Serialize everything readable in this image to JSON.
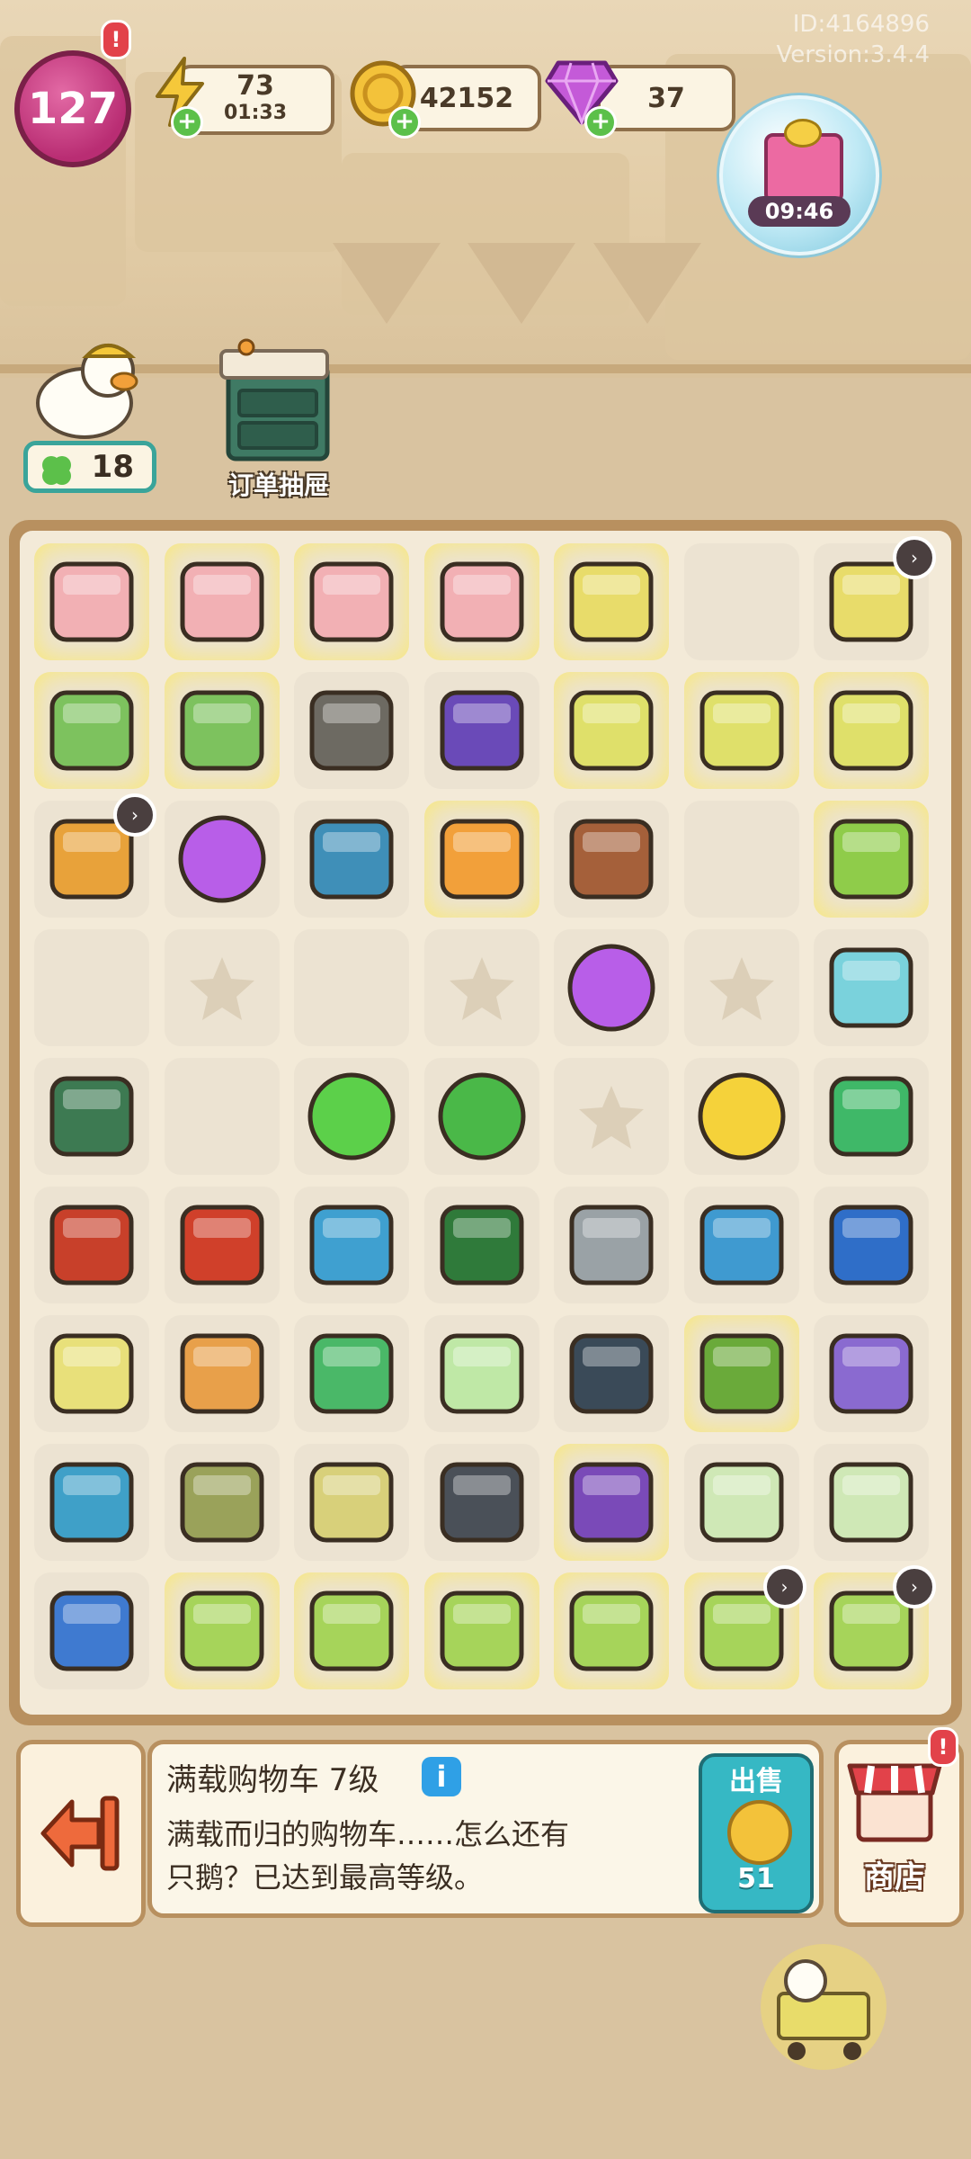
{
  "top_bar": {
    "level": "127",
    "energy": "73",
    "energy_timer": "01:33",
    "coins": "42152",
    "gems": "37",
    "gift_timer": "09:46",
    "id_text": "ID:4164896",
    "version_text": "Version:3.4.4"
  },
  "duck_count": "18",
  "drawer_label": "订单抽屉",
  "info": {
    "title": "满载购物车 7级",
    "description_line1": "满载而归的购物车……怎么还有",
    "description_line2": "只鹅？已达到最高等级。",
    "sell_label": "出售",
    "sell_price": "51",
    "info_icon": "i"
  },
  "shop_label": "商店",
  "plus_sign": "+",
  "alert_mark": "!",
  "timer_mark": "›",
  "colors": {
    "board_border": "#b8905f",
    "board_bg": "#f3ead8",
    "cell_bg": "#ece3d2",
    "sell_button": "#36b8c4",
    "level_badge": "#b92d73"
  },
  "grid": {
    "columns": 7,
    "rows": 9,
    "cells": [
      [
        "pink-cabinet-icon",
        "pink-cabinet-icon",
        "pink-cabinet-icon",
        "pink-cabinet-icon",
        "full-cart-icon",
        "empty",
        "cart-duck-icon"
      ],
      [
        "green-case-icon",
        "green-case-icon",
        "locker-icon",
        "purple-glasses-icon",
        "cart-icon",
        "cart-icon",
        "cart-icon"
      ],
      [
        "orange-drawer-icon",
        "energy-bubble-icon",
        "blue-books-icon",
        "flower-bouquet-icon",
        "wood-box-icon",
        "empty",
        "potted-plant-icon"
      ],
      [
        "empty",
        "star",
        "empty",
        "star",
        "energy-bubble-icon",
        "star",
        "dumbbell-icon"
      ],
      [
        "resistance-band-icon",
        "empty",
        "green-scissors-icon",
        "plus5-icon",
        "star",
        "energy-coin-icon",
        "green-hex-icon"
      ],
      [
        "jump-rope-icon",
        "red-key-icon",
        "blue-puzzle-icon",
        "green-bag-icon",
        "wrench-icon",
        "blue-machine-icon",
        "circuit-board-icon"
      ],
      [
        "yellow-basket-icon",
        "bracelet-icon",
        "dino-toy-icon",
        "egg-duck-icon",
        "dark-bag-icon",
        "green-toolbox-icon",
        "recipe-cards-icon"
      ],
      [
        "puzzle-pieces-icon",
        "cloth-stack-icon",
        "bear-cookie-icon",
        "elliptical-icon",
        "purple-box-icon",
        "duck-card-icon",
        "duck-card-icon"
      ],
      [
        "backpack-icon",
        "green-laptop-icon",
        "green-laptop-icon",
        "green-laptop-icon",
        "green-laptop-icon",
        "green-laptop-icon",
        "green-laptop-icon"
      ]
    ]
  }
}
